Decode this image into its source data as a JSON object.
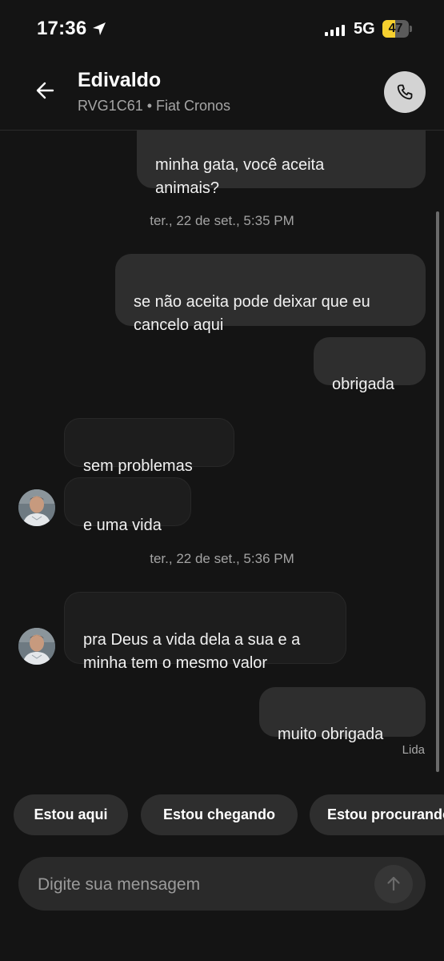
{
  "status_bar": {
    "time": "17:36",
    "network": "5G",
    "battery": "47",
    "battery_level": 0.47,
    "accent_color": "#f6d02f"
  },
  "header": {
    "back_icon": "arrow-left-icon",
    "contact_name": "Edivaldo",
    "vehicle": "RVG1C61 • Fiat Cronos",
    "call_icon": "phone-icon"
  },
  "messages": [
    {
      "direction": "out",
      "text": "minha gata, você aceita\nanimais?"
    },
    {
      "type": "timestamp",
      "text": "ter., 22 de set., 5:35 PM"
    },
    {
      "direction": "out",
      "text": "se não aceita pode deixar que eu\ncancelo aqui"
    },
    {
      "direction": "out",
      "text": "obrigada"
    },
    {
      "direction": "in",
      "text": "sem problemas"
    },
    {
      "direction": "in",
      "text": "e uma vida"
    },
    {
      "type": "timestamp",
      "text": "ter., 22 de set., 5:36 PM"
    },
    {
      "direction": "in",
      "text": "pra Deus a vida dela a sua e a\nminha tem o mesmo valor"
    },
    {
      "direction": "out",
      "text": "muito obrigada"
    }
  ],
  "read_receipt": "Lida",
  "quick_replies": [
    "Estou aqui",
    "Estou chegando",
    "Estou procurando"
  ],
  "composer": {
    "placeholder": "Digite sua mensagem",
    "send_icon": "arrow-up-icon"
  }
}
